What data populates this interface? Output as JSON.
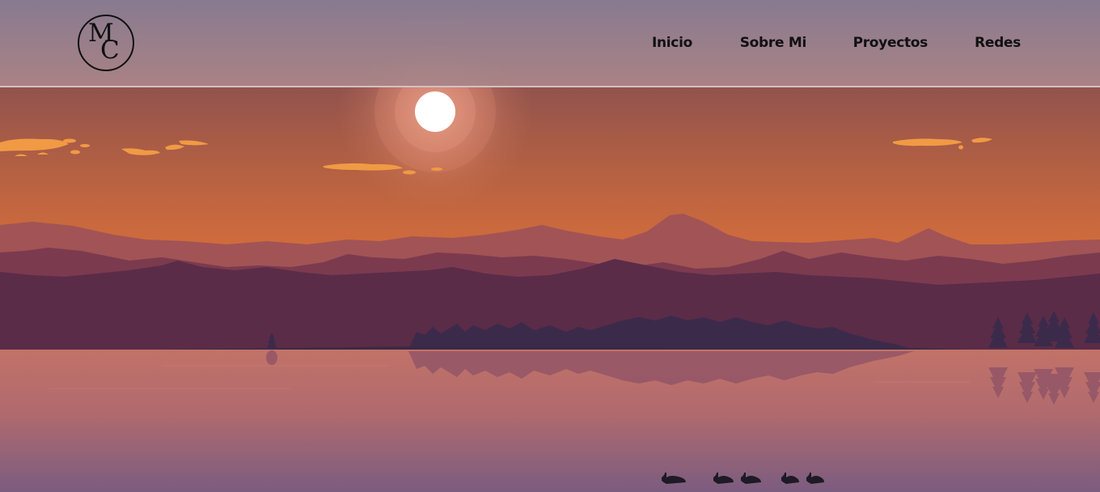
{
  "header": {
    "logo": {
      "text": "MC",
      "first": "M",
      "second": "C"
    },
    "nav": [
      {
        "label": "Inicio"
      },
      {
        "label": "Sobre Mi"
      },
      {
        "label": "Proyectos"
      },
      {
        "label": "Redes"
      }
    ]
  },
  "hero": {
    "scene": "sunset-lake-illustration",
    "colors": {
      "sky_top": "#8f5552",
      "sky_mid": "#b8623f",
      "sky_horizon": "#e0723a",
      "sun": "#ffffff",
      "clouds": "#f19a45",
      "far_mountains": "#9a4e55",
      "mid_mountains": "#7b3a4f",
      "near_hills": "#5a2c48",
      "trees": "#3b284a",
      "water_top": "#c07067",
      "water_bottom": "#7a5a7e",
      "ducks": "#1e1a26"
    }
  }
}
